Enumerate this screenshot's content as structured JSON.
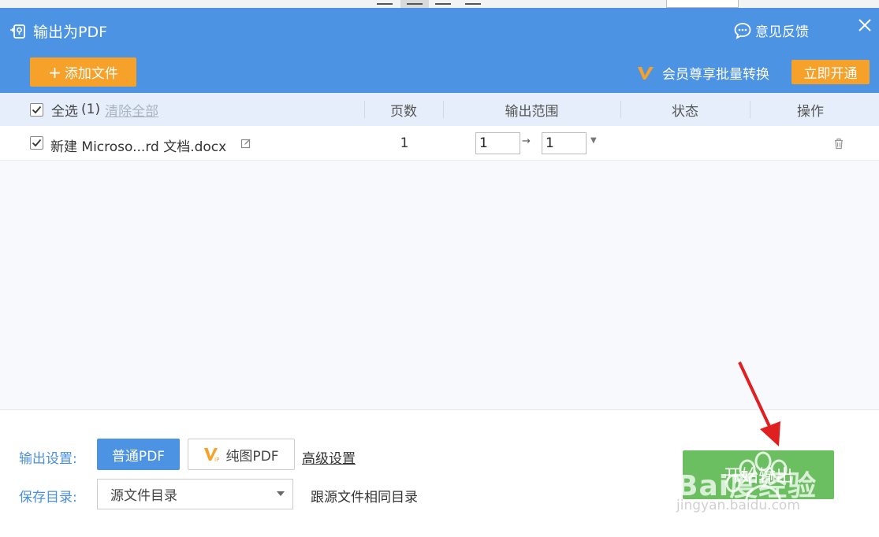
{
  "dialog": {
    "title": "输出为PDF",
    "feedback_label": "意见反馈",
    "add_file_label": "添加文件",
    "vip_text": "会员尊享批量转换",
    "open_vip_label": "立即开通"
  },
  "table": {
    "select_all_label": "全选",
    "select_count": "(1)",
    "clear_all_label": "清除全部",
    "columns": [
      "页数",
      "输出范围",
      "状态",
      "操作"
    ],
    "rows": [
      {
        "file_name": "新建 Microso...rd 文档.docx",
        "pages": "1",
        "range_from": "1",
        "range_to": "1",
        "status": ""
      }
    ]
  },
  "footer": {
    "output_settings_label": "输出设置:",
    "normal_pdf_label": "普通PDF",
    "image_pdf_label": "纯图PDF",
    "advanced_label": "高级设置",
    "save_dir_label": "保存目录:",
    "save_dir_value": "源文件目录",
    "save_dir_desc": "跟源文件相同目录",
    "start_label": "开始输出"
  },
  "watermark": {
    "text": "Bai度经验",
    "sub": "jingyan.baidu.com"
  },
  "colors": {
    "header_bg": "#4d93e3",
    "accent_orange": "#f5a12a",
    "start_green": "#6cbf61",
    "table_header_bg": "#e5eefa",
    "annotation_red": "#e02020"
  }
}
